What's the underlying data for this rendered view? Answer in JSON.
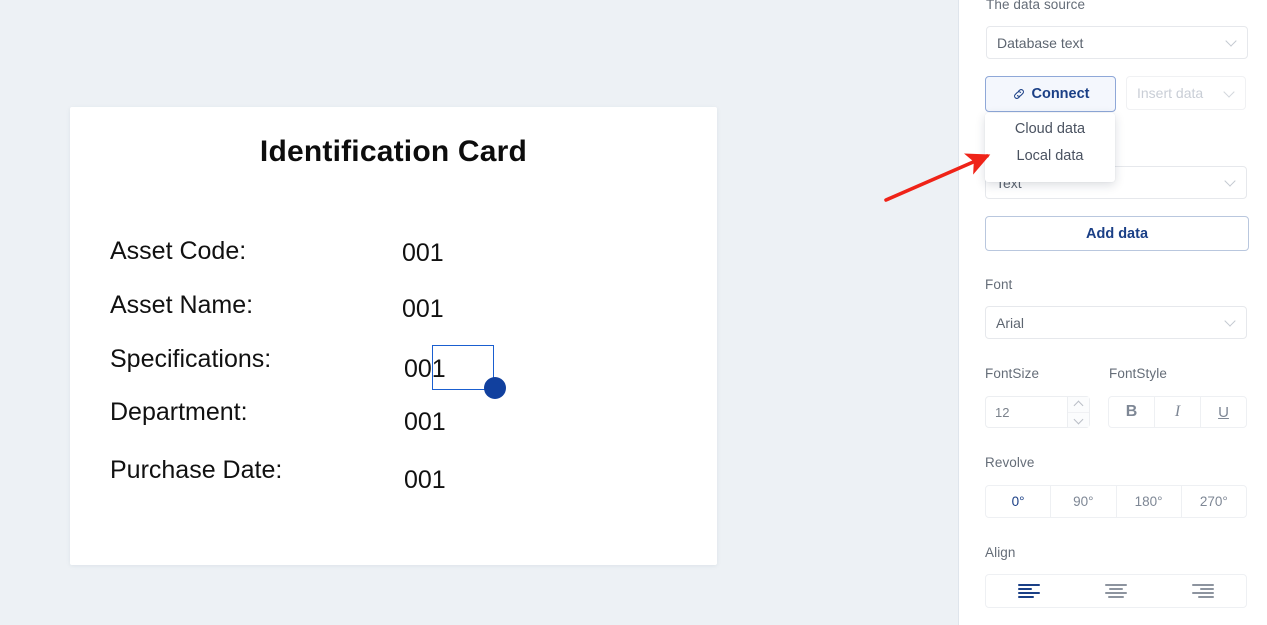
{
  "card": {
    "title": "Identification Card",
    "fields": [
      {
        "label": "Asset Code:",
        "value": "001"
      },
      {
        "label": "Asset Name:",
        "value": "001"
      },
      {
        "label": "Specifications:",
        "value": "001"
      },
      {
        "label": "Department:",
        "value": "001"
      },
      {
        "label": "Purchase Date:",
        "value": "001"
      }
    ],
    "selected_field_index": 0
  },
  "panel": {
    "data_source": {
      "label": "The data source",
      "selected": "Database text"
    },
    "connect_button": "Connect",
    "connect_icon": "link-icon",
    "insert_data_button": "Insert data",
    "insert_data_disabled": true,
    "dropdown": {
      "open": true,
      "items": [
        "Cloud data",
        "Local data"
      ],
      "highlighted": "Local data"
    },
    "type_select": {
      "selected": "Text"
    },
    "add_data_button": "Add data",
    "font": {
      "label": "Font",
      "selected": "Arial"
    },
    "font_size": {
      "label": "FontSize",
      "value": "12"
    },
    "font_style": {
      "label": "FontStyle",
      "options": [
        "B",
        "I",
        "U"
      ],
      "active": []
    },
    "revolve": {
      "label": "Revolve",
      "options": [
        "0°",
        "90°",
        "180°",
        "270°"
      ],
      "active": "0°"
    },
    "align": {
      "label": "Align",
      "options": [
        "align-left",
        "align-center",
        "align-right"
      ],
      "active": "align-left"
    }
  },
  "annotation": {
    "arrow_color": "#ef2318",
    "points_to": "Local data"
  },
  "colors": {
    "canvas_bg": "#edf1f5",
    "panel_bg": "#ffffff",
    "accent": "#1a3f86",
    "selection": "#11409e"
  }
}
